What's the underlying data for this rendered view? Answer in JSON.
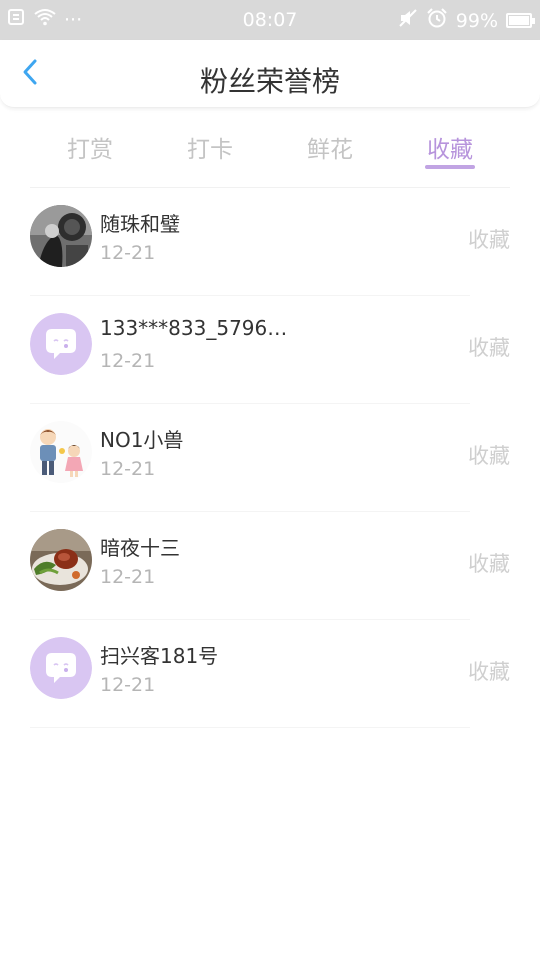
{
  "status_bar": {
    "time": "08:07",
    "battery": "99%",
    "more_dots": "···"
  },
  "header": {
    "title": "粉丝荣誉榜"
  },
  "tabs": [
    {
      "label": "打赏",
      "active": false
    },
    {
      "label": "打卡",
      "active": false
    },
    {
      "label": "鲜花",
      "active": false
    },
    {
      "label": "收藏",
      "active": true
    }
  ],
  "list": [
    {
      "name": "随珠和璧",
      "date": "12-21",
      "action": "收藏",
      "avatar": "photo-bw-avatar"
    },
    {
      "name": "133***833_5796…",
      "date": "12-21",
      "action": "收藏",
      "avatar": "default-chat-avatar"
    },
    {
      "name": "NO1小兽",
      "date": "12-21",
      "action": "收藏",
      "avatar": "cartoon-couple-avatar"
    },
    {
      "name": "暗夜十三",
      "date": "12-21",
      "action": "收藏",
      "avatar": "food-photo-avatar"
    },
    {
      "name": "扫兴客181号",
      "date": "12-21",
      "action": "收藏",
      "avatar": "default-chat-avatar"
    }
  ],
  "colors": {
    "accent": "#b794dc",
    "status_bar_bg": "#d9d9d9",
    "back_arrow": "#3ea6f0",
    "default_avatar": "#d9c6f2"
  }
}
